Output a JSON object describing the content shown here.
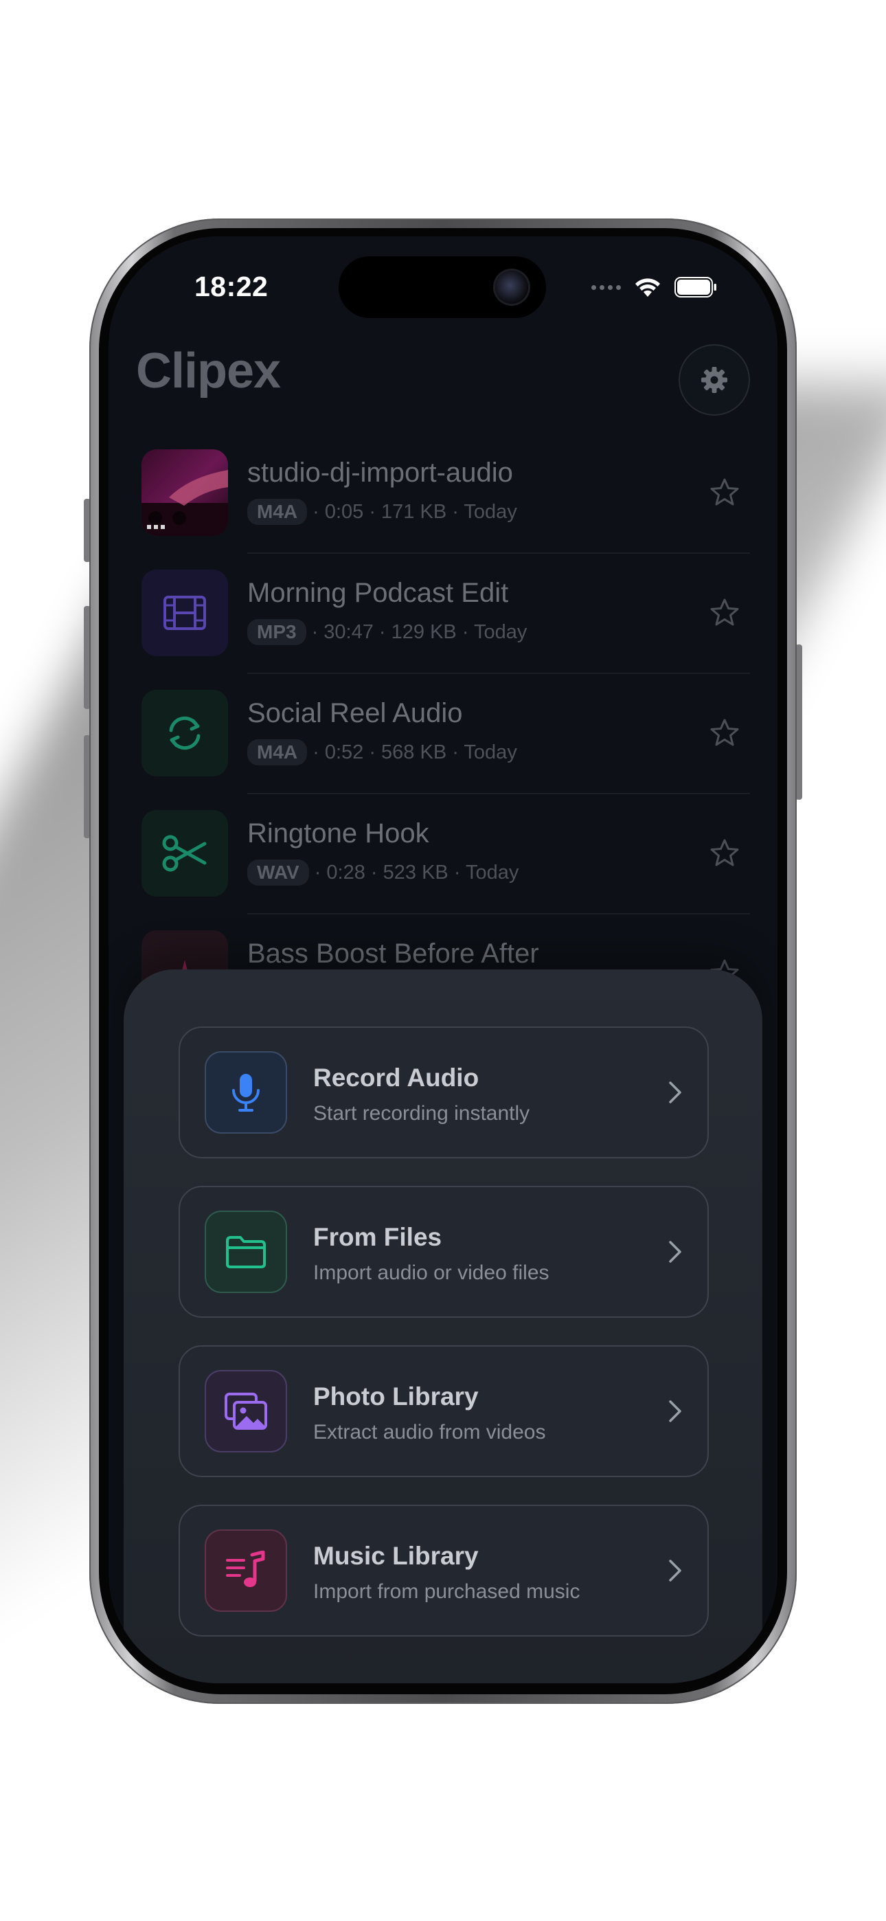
{
  "status_bar": {
    "time": "18:22"
  },
  "header": {
    "app_title": "Clipex",
    "settings_icon": "gear-icon"
  },
  "recordings": [
    {
      "title": "studio-dj-import-audio",
      "format": "M4A",
      "details": "· 0:05 · 171 KB · Today",
      "thumb": "photo",
      "icon": "studio-photo"
    },
    {
      "title": "Morning Podcast Edit",
      "format": "MP3",
      "details": "· 30:47 · 129 KB · Today",
      "thumb": "icon",
      "icon": "film-icon",
      "accent": "#6c4fd6"
    },
    {
      "title": "Social Reel Audio",
      "format": "M4A",
      "details": "· 0:52 · 568 KB · Today",
      "thumb": "icon",
      "icon": "sync-icon",
      "accent": "#1fb88a"
    },
    {
      "title": "Ringtone Hook",
      "format": "WAV",
      "details": "· 0:28 · 523 KB · Today",
      "thumb": "icon",
      "icon": "scissors-icon",
      "accent": "#1fb88a"
    },
    {
      "title": "Bass Boost Before After",
      "format": "",
      "details": "",
      "thumb": "icon",
      "icon": "sparkle-icon",
      "accent": "#d6367a"
    }
  ],
  "import_sheet": {
    "options": [
      {
        "title": "Record Audio",
        "subtitle": "Start recording instantly",
        "icon": "microphone-icon",
        "accent": "#3b82f6"
      },
      {
        "title": "From Files",
        "subtitle": "Import audio or video files",
        "icon": "folder-icon",
        "accent": "#22c08c"
      },
      {
        "title": "Photo Library",
        "subtitle": "Extract audio from videos",
        "icon": "photos-icon",
        "accent": "#9b6cf0"
      },
      {
        "title": "Music Library",
        "subtitle": "Import from purchased music",
        "icon": "music-note-icon",
        "accent": "#e4368a"
      }
    ]
  },
  "colors": {
    "background": "#0d1117",
    "sheet": "#272b33",
    "text_muted": "#6c6f76"
  }
}
